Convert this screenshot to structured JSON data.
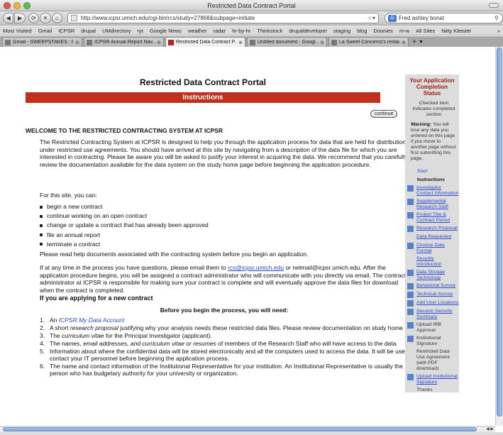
{
  "window": {
    "title": "Restricted Data Contract Portal"
  },
  "toolbar": {
    "back": "◀",
    "forward": "▶",
    "reload": "⟳",
    "stop": "✕",
    "home": "⌂",
    "url": "http://www.icpsr.umich.edu/cgi-bin/rcs/study=27868&subpage=initiate",
    "search": "Fred ashley bonat"
  },
  "bookmarks": [
    "Most Visited",
    "Gmail",
    "ICPSR",
    "drupal",
    "UMdirectory",
    "ryt",
    "Google News",
    "weather",
    "radar",
    "hr-by-hr",
    "Thinkstock",
    "drupaldeveloper",
    "staging",
    "blog",
    "Doonies",
    "m-w",
    "All Sites",
    "Nitty Kleister"
  ],
  "bookmarks_more": "»",
  "tabs": [
    {
      "label": "Gmail - SWEEPSTAKES : Fr...",
      "active": false
    },
    {
      "label": "ICPSR Annual Report Nav...",
      "active": false
    },
    {
      "label": "Restricted Data Contract P...",
      "active": true
    },
    {
      "label": "Untitled document - Googl...",
      "active": false
    },
    {
      "label": "La Sweet Concerns's restau...",
      "active": false
    }
  ],
  "page": {
    "title": "Restricted Data Contract Portal",
    "section_header": "Instructions",
    "continue_label": "continue",
    "welcome": "WELCOME TO THE RESTRICTED CONTRACTING SYSTEM AT ICPSR",
    "intro": "The Restricted Contracting System at ICPSR is designed to help you through the application process for data that are held for distribution under restricted use agreements. You should have arrived at this site by navigating from a description of the data file for which you are interested in contracting. Please be aware you will be asked to justify your interest in acquiring the data. We recommend that you carefully review the documentation available for the data system on the study home page before beginning the application procedure.",
    "can_do_intro": "For this site, you can:",
    "can_do": [
      "begin a new contract",
      "continue working on an open contract",
      "change or update a contract that has already been approved",
      "file an annual report",
      "terminate a contract"
    ],
    "help_note": "Please read help documents associated with the contracting system before you begin an application.",
    "questions_pre": "If at any time in the process you have questions, please email them to ",
    "email1": "rcs@icpsr.umich.edu",
    "questions_mid": " or netmail@icpsr.umich.edu. After the application procedure begins, you will be assigned a contract administrator who will communicate with you directly via email. The contract administrator at ICPSR is responsible for making sure your contract is complete and will eventually approve the data files for download when the contract is completed.",
    "new_contract_heading": "If you are applying for a new contract",
    "before_heading": "Before you begin the process, you will need:",
    "needs": [
      {
        "num": "1.",
        "pre": "An ",
        "em": "ICPSR My Data Account",
        "post": ""
      },
      {
        "num": "2.",
        "pre": "A short ",
        "em": "research proposal",
        "post": " justifying why your analysis needs these restricted data files. Please review documentation on study home page."
      },
      {
        "num": "3.",
        "pre": "The ",
        "em": "curriculum vitae",
        "post": " for the Principal Investigator (applicant)."
      },
      {
        "num": "4.",
        "pre": "The ",
        "em": "names, email addresses, and curriculum vitae or resumes",
        "post": " of members of the Research Staff who will have access to the data."
      },
      {
        "num": "5.",
        "pre": "",
        "em": "",
        "post": "Information about where the confidential data will be stored electronically and all the computers used to access the data. It will be useful to contact your IT personnel before beginning the application process."
      },
      {
        "num": "6.",
        "pre": "",
        "em": "",
        "post": "The name and contact information of the Institutional Representative for your institution. An Institutional Representative is usually the person who has budgetary authority for your university or organization."
      }
    ]
  },
  "sidebar": {
    "heading": "Your Application Completion Status",
    "note": "Checked item indicates completed section",
    "warning_label": "Warning:",
    "warning_text": " You will lose any data you entered on this page if you move to another page without first submitting this page.",
    "start": "Start",
    "instructions": "Instructions",
    "items": [
      {
        "label": "Investigator Contact Information",
        "checked": true,
        "link": true
      },
      {
        "label": "Supplemental Research Staff",
        "checked": true,
        "link": true
      },
      {
        "label": "Project Title & Contract Period",
        "checked": true,
        "link": true
      },
      {
        "label": "Research Proposal",
        "checked": true,
        "link": true
      },
      {
        "label": "Data Requested",
        "checked": false,
        "link": true
      },
      {
        "label": "Choose Data Format",
        "checked": true,
        "link": true
      },
      {
        "label": "Security Introduction",
        "checked": false,
        "link": true
      },
      {
        "label": "Data Storage Technology",
        "checked": true,
        "link": true
      },
      {
        "label": "Behavioral Survey",
        "checked": true,
        "link": true
      },
      {
        "label": "Technical Survey",
        "checked": true,
        "link": true
      },
      {
        "label": "Add User Locations",
        "checked": true,
        "link": true
      },
      {
        "label": "Session Security Summary",
        "checked": true,
        "link": true
      },
      {
        "label": "Upload IRB Approval",
        "checked": true,
        "link": false
      },
      {
        "label": "Institutional Signature",
        "checked": true,
        "link": false
      },
      {
        "label": "Restricted Data Use Agreement (with PDF download)",
        "checked": false,
        "link": false
      },
      {
        "label": "Upload Institutional Signature",
        "checked": true,
        "link": true
      },
      {
        "label": "Thanks",
        "checked": false,
        "link": false
      }
    ]
  },
  "colors": {
    "accent_red": "#c1301c",
    "link_blue": "#2a4bd0",
    "sidebar_bg": "#dcdcdc",
    "check_blue": "#5b82c5"
  }
}
